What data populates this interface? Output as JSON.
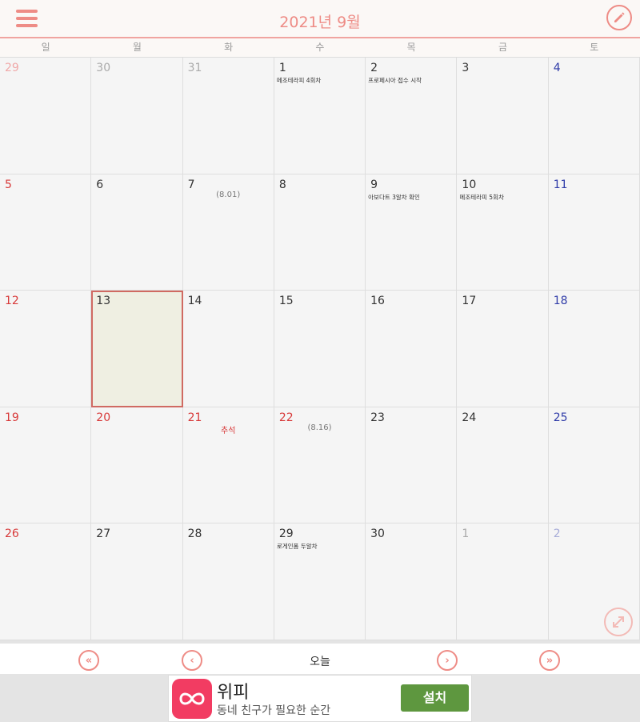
{
  "header": {
    "title": "2021년 9월"
  },
  "weekdays": [
    "일",
    "월",
    "화",
    "수",
    "목",
    "금",
    "토"
  ],
  "weeks": [
    [
      {
        "day": "29",
        "kind": "sun",
        "muted": true
      },
      {
        "day": "30",
        "kind": "",
        "muted": true
      },
      {
        "day": "31",
        "kind": "",
        "muted": true
      },
      {
        "day": "1",
        "kind": "",
        "event": "메조테라피 4회차"
      },
      {
        "day": "2",
        "kind": "",
        "event": "프로페시아 접수 시작"
      },
      {
        "day": "3",
        "kind": ""
      },
      {
        "day": "4",
        "kind": "sat"
      }
    ],
    [
      {
        "day": "5",
        "kind": "sun"
      },
      {
        "day": "6",
        "kind": ""
      },
      {
        "day": "7",
        "kind": "",
        "lunar": "(8.01)"
      },
      {
        "day": "8",
        "kind": ""
      },
      {
        "day": "9",
        "kind": "",
        "event": "아보다트 3알차 확인"
      },
      {
        "day": "10",
        "kind": "",
        "event": "메조테라피 5회차"
      },
      {
        "day": "11",
        "kind": "sat"
      }
    ],
    [
      {
        "day": "12",
        "kind": "sun"
      },
      {
        "day": "13",
        "kind": "",
        "selected": true
      },
      {
        "day": "14",
        "kind": ""
      },
      {
        "day": "15",
        "kind": ""
      },
      {
        "day": "16",
        "kind": ""
      },
      {
        "day": "17",
        "kind": ""
      },
      {
        "day": "18",
        "kind": "sat"
      }
    ],
    [
      {
        "day": "19",
        "kind": "sun"
      },
      {
        "day": "20",
        "kind": "sun"
      },
      {
        "day": "21",
        "kind": "sun",
        "holiday": "추석"
      },
      {
        "day": "22",
        "kind": "sun",
        "lunar": "(8.16)"
      },
      {
        "day": "23",
        "kind": ""
      },
      {
        "day": "24",
        "kind": ""
      },
      {
        "day": "25",
        "kind": "sat"
      }
    ],
    [
      {
        "day": "26",
        "kind": "sun"
      },
      {
        "day": "27",
        "kind": ""
      },
      {
        "day": "28",
        "kind": ""
      },
      {
        "day": "29",
        "kind": "",
        "event": "로게인폼 두알차"
      },
      {
        "day": "30",
        "kind": ""
      },
      {
        "day": "1",
        "kind": "",
        "muted": true
      },
      {
        "day": "2",
        "kind": "sat",
        "muted": true
      }
    ]
  ],
  "nav": {
    "first": "«",
    "prev": "‹",
    "today": "오늘",
    "next": "›",
    "last": "»"
  },
  "ad": {
    "name": "위피",
    "description": "동네 친구가 필요한 순간",
    "install": "설치"
  },
  "colors": {
    "accent": "#ee8c86",
    "sunday": "#d83a3a",
    "saturday": "#2f3ba8",
    "ad_brand": "#f23c62",
    "install": "#5e973f"
  },
  "icons": {
    "menu": "hamburger-icon",
    "edit": "pencil-icon",
    "expand": "expand-arrows-icon",
    "ad_logo": "infinity-heart-icon"
  }
}
